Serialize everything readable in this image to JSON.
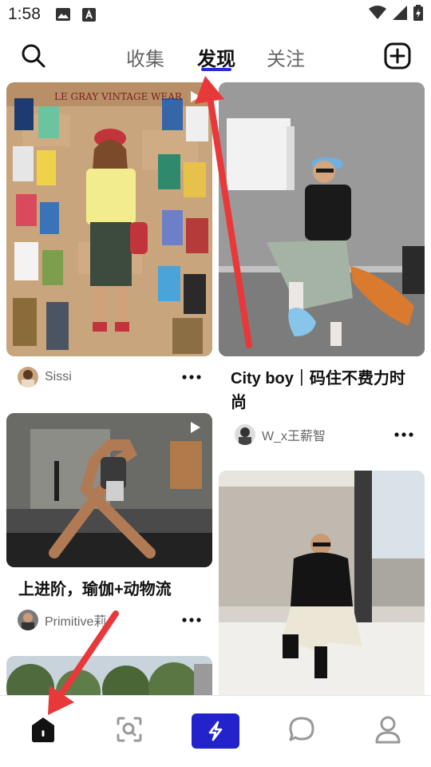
{
  "status_bar": {
    "time": "1:58"
  },
  "header": {
    "tabs": [
      {
        "label": "收集"
      },
      {
        "label": "发现"
      },
      {
        "label": "关注"
      }
    ],
    "active_tab": "发现",
    "accent_color": "#2b2bd8"
  },
  "feed": {
    "cards": [
      {
        "author": "Sissi",
        "video": true
      },
      {
        "title": "City boy｜码住不费力时尚",
        "author": "W_x王薪智"
      },
      {
        "title": "上进阶，瑜伽+动物流",
        "author": "Primitive莉",
        "video": true
      },
      {},
      {}
    ]
  },
  "bottom_nav": {
    "items": [
      {
        "icon": "home-icon"
      },
      {
        "icon": "scan-icon"
      },
      {
        "icon": "lightning-icon"
      },
      {
        "icon": "chat-icon"
      },
      {
        "icon": "profile-icon"
      }
    ],
    "boost_color": "#2323cc"
  },
  "annotations": {
    "arrow_color": "#e8383a"
  }
}
